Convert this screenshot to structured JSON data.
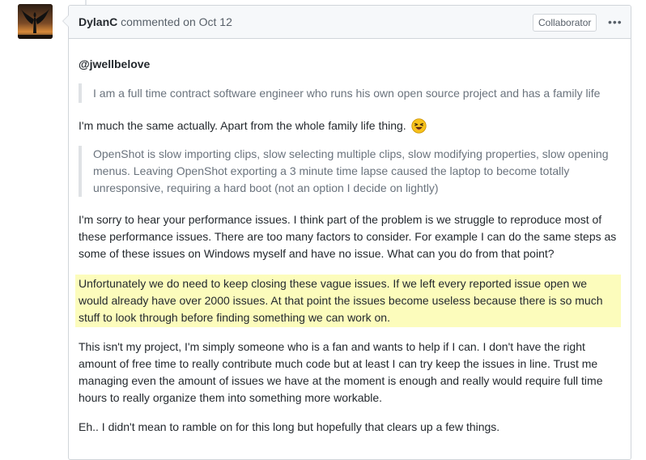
{
  "comment": {
    "author": "DylanC",
    "meta": "commented on Oct 12",
    "badge": "Collaborator",
    "more_icon": "kebab-horizontal-icon",
    "mention": "@jwellbelove",
    "quote1": "I am a full time contract software engineer who runs his own open source project and has a family life",
    "para1": "I'm much the same actually. Apart from the whole family life thing.",
    "emoji": "laughing-face-icon",
    "quote2": "OpenShot is slow importing clips, slow selecting multiple clips, slow modifying properties, slow opening menus. Leaving OpenShot exporting a 3 minute time lapse caused the laptop to become totally unresponsive, requiring a hard boot (not an option I decide on lightly)",
    "para2": "I'm sorry to hear your performance issues. I think part of the problem is we struggle to reproduce most of these performance issues. There are too many factors to consider. For example I can do the same steps as some of these issues on Windows myself and have no issue. What can you do from that point?",
    "para3_highlighted": "Unfortunately we do need to keep closing these vague issues. If we left every reported issue open we would already have over 2000 issues. At that point the issues become useless because there is so much stuff to look through before finding something we can work on.",
    "para4": "This isn't my project, I'm simply someone who is a fan and wants to help if I can. I don't have the right amount of free time to really contribute much code but at least I can try keep the issues in line. Trust me managing even the amount of issues we have at the moment is enough and really would require full time hours to really organize them into something more workable.",
    "para5": "Eh.. I didn't mean to ramble on for this long but hopefully that clears up a few things."
  },
  "colors": {
    "highlight": "#fcfcbc",
    "header_bg": "#f6f8fa",
    "border": "#d1d5da",
    "quote_text": "#6a737d"
  }
}
